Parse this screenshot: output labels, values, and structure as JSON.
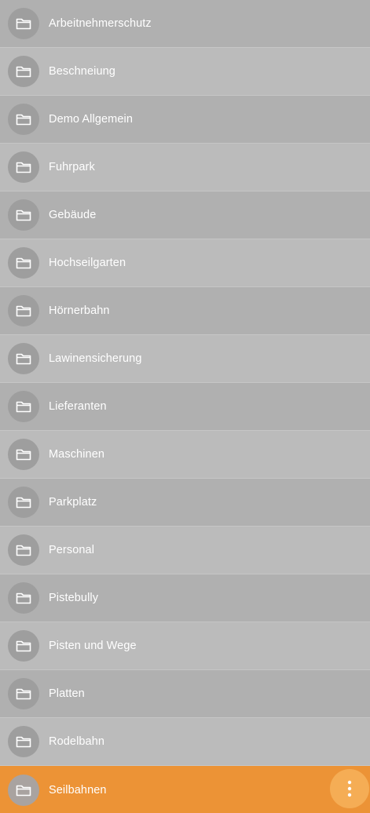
{
  "folders": [
    {
      "label": "Arbeitnehmerschutz",
      "icon": "folder-icon"
    },
    {
      "label": "Beschneiung",
      "icon": "folder-icon"
    },
    {
      "label": "Demo Allgemein",
      "icon": "folder-icon"
    },
    {
      "label": "Fuhrpark",
      "icon": "folder-icon"
    },
    {
      "label": "Gebäude",
      "icon": "folder-icon"
    },
    {
      "label": "Hochseilgarten",
      "icon": "folder-icon"
    },
    {
      "label": "Hörnerbahn",
      "icon": "folder-icon"
    },
    {
      "label": "Lawinensicherung",
      "icon": "folder-icon"
    },
    {
      "label": "Lieferanten",
      "icon": "folder-icon"
    },
    {
      "label": "Maschinen",
      "icon": "folder-icon"
    },
    {
      "label": "Parkplatz",
      "icon": "folder-icon"
    },
    {
      "label": "Personal",
      "icon": "folder-icon"
    },
    {
      "label": "Pistebully",
      "icon": "folder-icon"
    },
    {
      "label": "Pisten und Wege",
      "icon": "folder-icon"
    },
    {
      "label": "Platten",
      "icon": "folder-icon"
    },
    {
      "label": "Rodelbahn",
      "icon": "folder-icon"
    },
    {
      "label": "Seilbahnen",
      "icon": "folder-icon",
      "active": true
    }
  ],
  "active_action_icon": "more-vertical-icon",
  "colors": {
    "row_dark": "#b0b0b0",
    "row_light": "#bbbbbb",
    "active_row": "#ec9336",
    "fab": "#f5ad55",
    "avatar": "#9e9e9e",
    "text": "#ffffff"
  }
}
